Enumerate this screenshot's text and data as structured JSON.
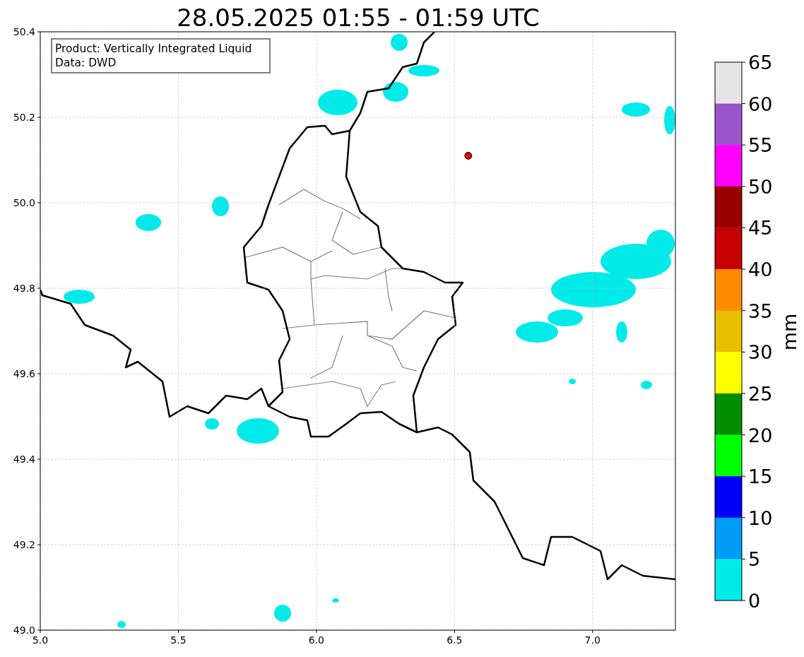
{
  "title": "28.05.2025 01:55 - 01:59 UTC",
  "info_box": [
    "Product: Vertically Integrated Liquid",
    "Data: DWD"
  ],
  "map": {
    "chart_data": {
      "type": "scatter",
      "grid": true,
      "xlim": [
        5.0,
        7.3
      ],
      "ylim": [
        49.0,
        50.4
      ],
      "xticks": [
        {
          "value": 5.0,
          "label": "5.0"
        },
        {
          "value": 5.5,
          "label": "5.5"
        },
        {
          "value": 6.0,
          "label": "6.0"
        },
        {
          "value": 6.5,
          "label": "6.5"
        },
        {
          "value": 7.0,
          "label": "7.0"
        }
      ],
      "yticks": [
        {
          "value": 49.0,
          "label": "49.0"
        },
        {
          "value": 49.2,
          "label": "49.2"
        },
        {
          "value": 49.4,
          "label": "49.4"
        },
        {
          "value": 49.6,
          "label": "49.6"
        },
        {
          "value": 49.8,
          "label": "49.8"
        },
        {
          "value": 50.0,
          "label": "50.0"
        },
        {
          "value": 50.2,
          "label": "50.2"
        },
        {
          "value": 50.4,
          "label": "50.4"
        }
      ],
      "x": [
        6.55
      ],
      "series": [
        {
          "color": "#ee0000",
          "values": [
            50.11
          ]
        }
      ]
    }
  },
  "colorbar": {
    "label": "mm",
    "bins": [
      {
        "color": "#e5e5e5"
      },
      {
        "color": "#9955c9"
      },
      {
        "color": "#ff00ff"
      },
      {
        "color": "#980000"
      },
      {
        "color": "#c60000"
      },
      {
        "color": "#ff8c00"
      },
      {
        "color": "#e7bf00"
      },
      {
        "color": "#ffff00"
      },
      {
        "color": "#008e00"
      },
      {
        "color": "#00ff00"
      },
      {
        "color": "#0000f7"
      },
      {
        "color": "#009cf7"
      },
      {
        "color": "#00eaea"
      }
    ],
    "ticks": [
      "65",
      "60",
      "55",
      "50",
      "45",
      "40",
      "35",
      "30",
      "25",
      "20",
      "15",
      "10",
      "5",
      "0"
    ]
  }
}
